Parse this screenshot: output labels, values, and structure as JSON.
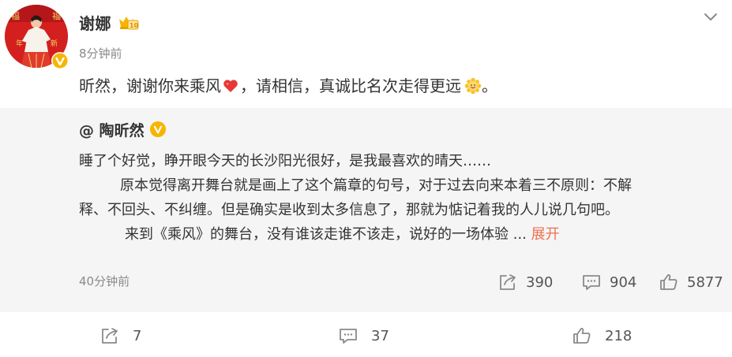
{
  "post": {
    "author": "谢娜",
    "time": "8分钟前",
    "text_part1": "昕然，谢谢你来乘风",
    "text_part2": "，请相信，真诚比名次走得更远",
    "text_part3": "。",
    "icons": [
      "verified-badge-icon",
      "vip-crown-icon",
      "chevron-down-icon",
      "heart-emoji",
      "sunflower-emoji"
    ]
  },
  "repost": {
    "author": "@ 陶昕然",
    "line1": "睡了个好觉，睁开眼今天的长沙阳光很好，是我最喜欢的晴天……",
    "line2": "原本觉得离开舞台就是画上了这个篇章的句号，对于过去向来本着三不原则：不解",
    "line3": "释、不回头、不纠缠。但是确实是收到太多信息了，那就为惦记着我的人儿说几句吧。",
    "line4": "来到《乘风》的舞台，没有谁该走谁不该走，说好的一场体验 ...",
    "expand": "展开",
    "time": "40分钟前",
    "reposts": "390",
    "comments": "904",
    "likes": "5877"
  },
  "footer": {
    "reposts": "7",
    "comments": "37",
    "likes": "218"
  },
  "colors": {
    "link": "#eb7350",
    "card_bg": "#f5f5f5",
    "badge": "#f7b500",
    "heart": "#e53935"
  }
}
